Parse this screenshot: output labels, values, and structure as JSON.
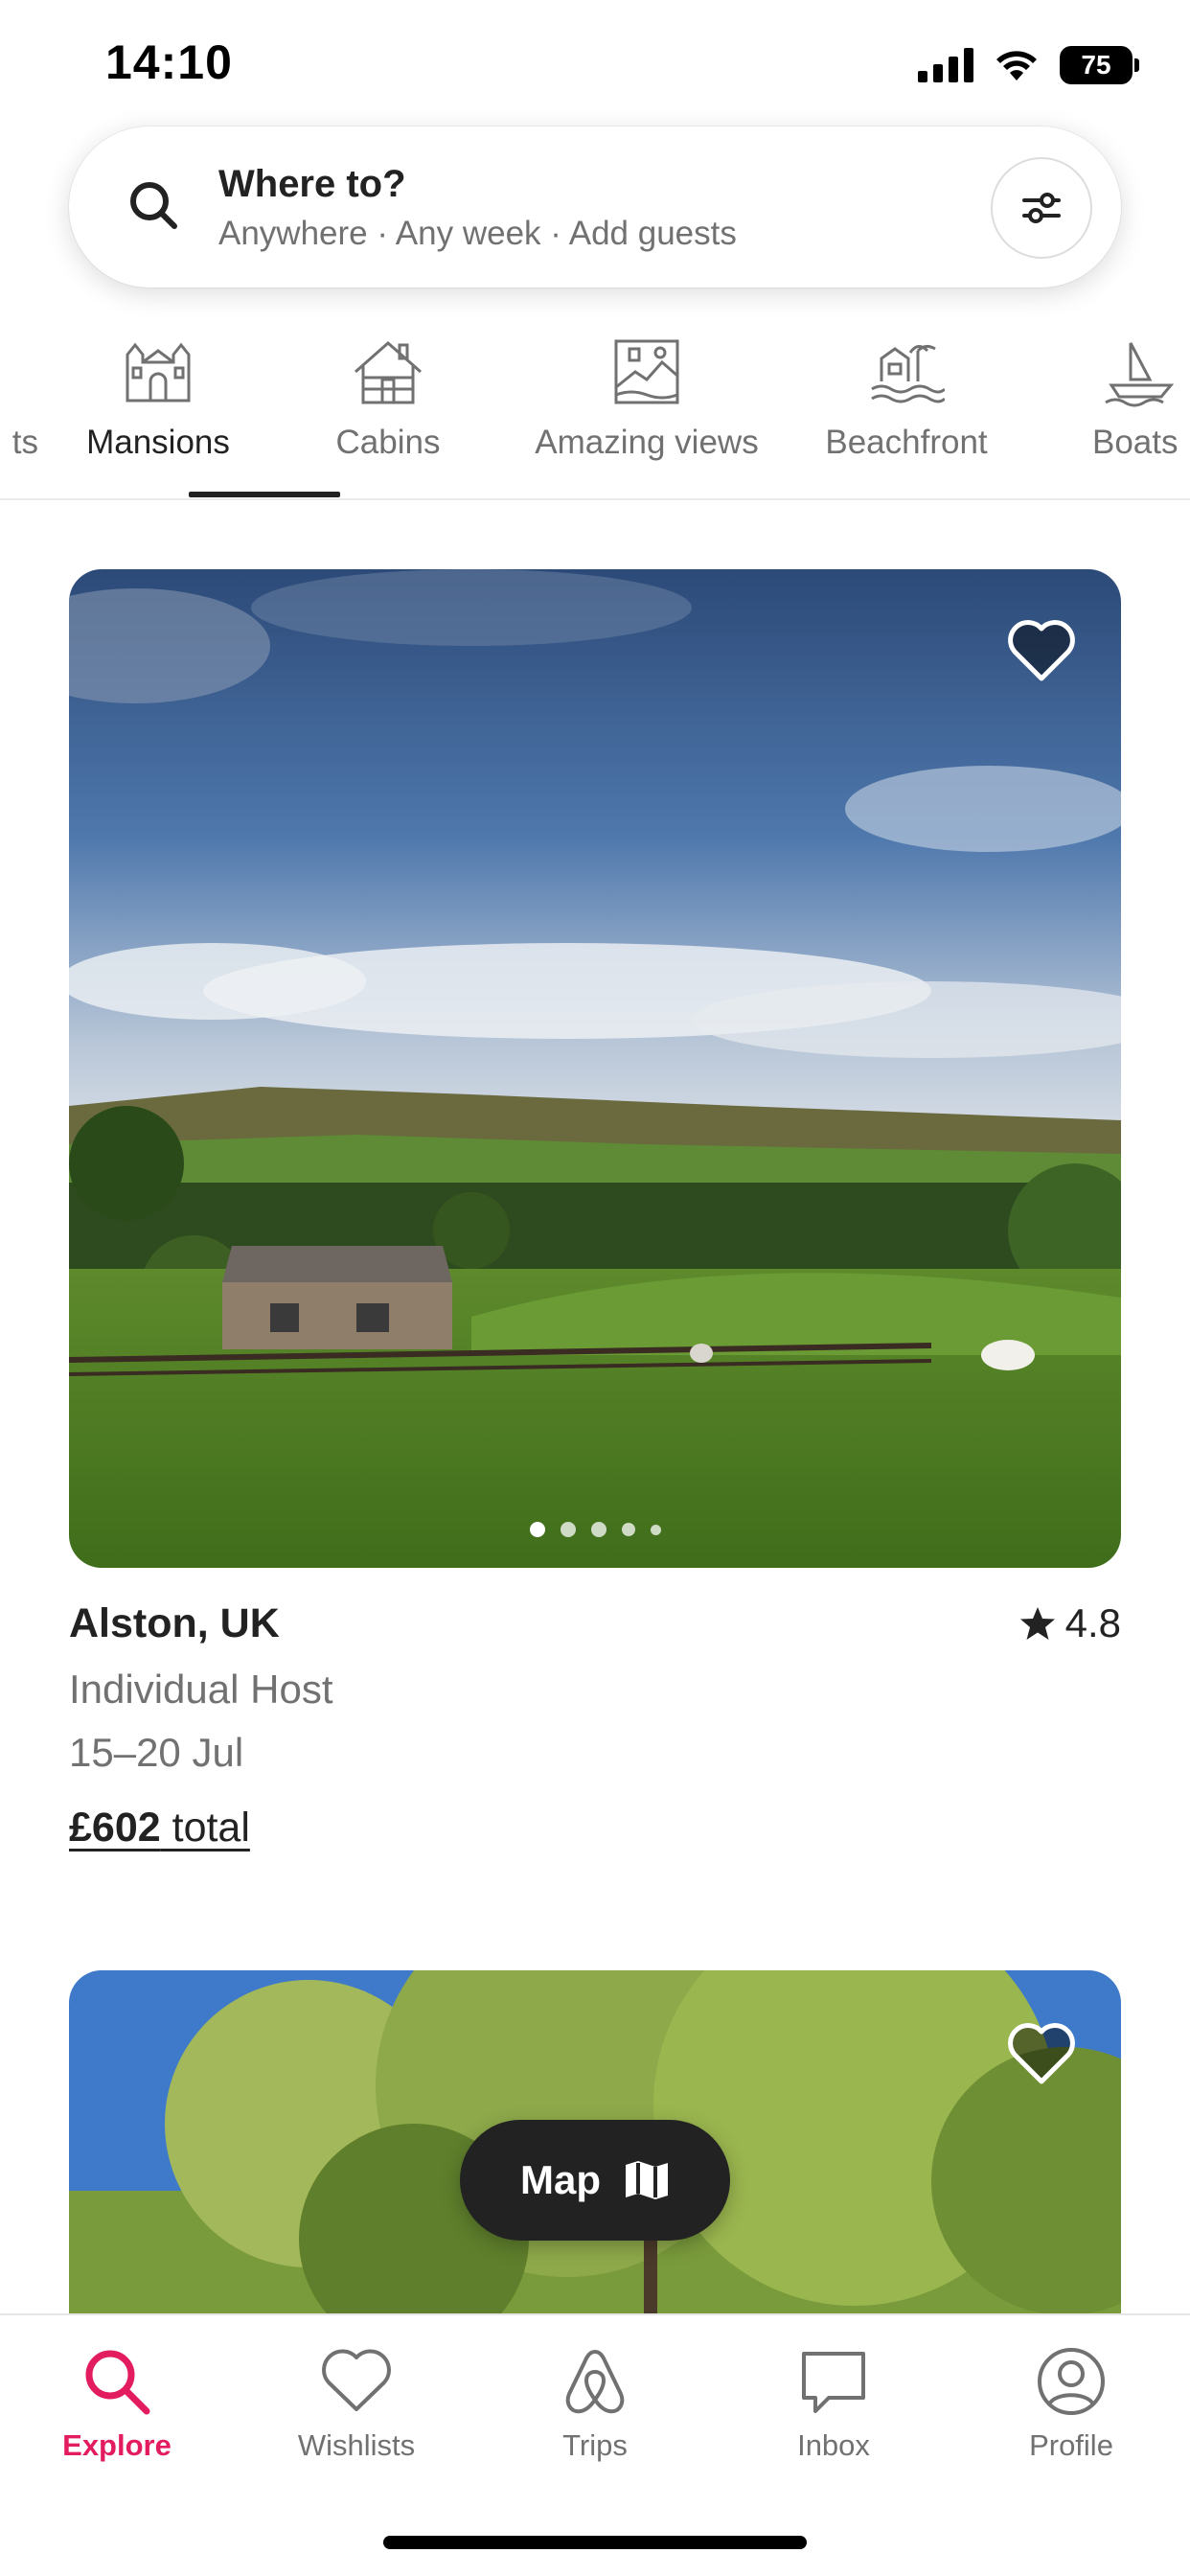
{
  "status_bar": {
    "time": "14:10",
    "battery": "75"
  },
  "search": {
    "title": "Where to?",
    "subtitle": "Anywhere · Any week · Add guests"
  },
  "categories": [
    {
      "label": "ts",
      "icon": "category-icon"
    },
    {
      "label": "Mansions",
      "icon": "mansion-icon",
      "selected": true
    },
    {
      "label": "Cabins",
      "icon": "cabin-icon"
    },
    {
      "label": "Amazing views",
      "icon": "view-icon"
    },
    {
      "label": "Beachfront",
      "icon": "beachfront-icon"
    },
    {
      "label": "Boats",
      "icon": "boat-icon"
    }
  ],
  "listings": [
    {
      "location": "Alston, UK",
      "rating": "4.8",
      "host": "Individual Host",
      "dates": "15–20 Jul",
      "price_amount": "£602",
      "price_suffix": " total",
      "photo_count": 5,
      "current_photo": 1
    },
    {
      "location": "",
      "photo": "trees-field"
    }
  ],
  "map_button": {
    "label": "Map"
  },
  "nav": [
    {
      "label": "Explore",
      "icon": "search-icon",
      "active": true
    },
    {
      "label": "Wishlists",
      "icon": "heart-icon"
    },
    {
      "label": "Trips",
      "icon": "airbnb-logo-icon"
    },
    {
      "label": "Inbox",
      "icon": "message-icon"
    },
    {
      "label": "Profile",
      "icon": "profile-icon"
    }
  ],
  "colors": {
    "accent": "#e31c5f",
    "text": "#222222",
    "muted": "#717171"
  }
}
